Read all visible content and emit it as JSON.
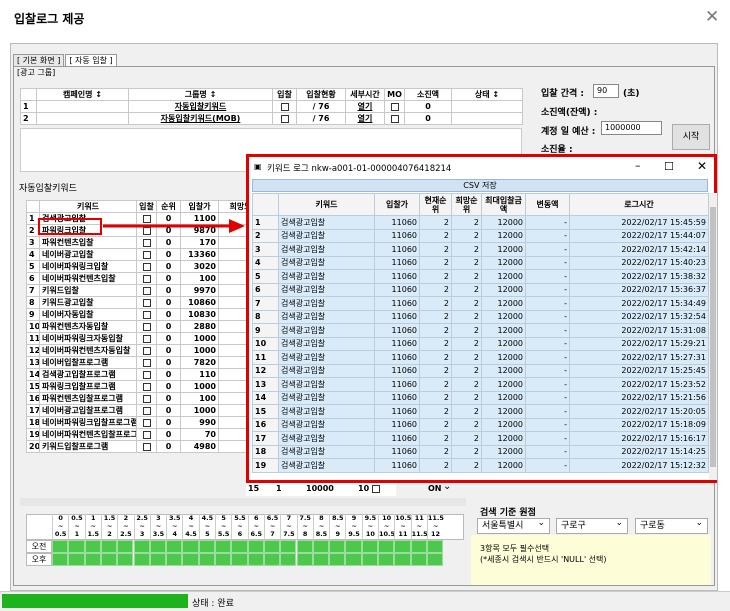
{
  "dialog": {
    "title": "입찰로그 제공"
  },
  "tabs": [
    "[ 기본 화면 ]",
    "[ 자동 입찰 ]"
  ],
  "ad_group": {
    "label": "[광고 그룹]",
    "headers": [
      "캠페인명 ↕",
      "그룹명 ↕",
      "입찰",
      "입찰현황",
      "세부시간",
      "MO",
      "소진액",
      "상태 ↕"
    ],
    "rows": [
      {
        "n": "1",
        "group": "자동입찰키워드",
        "status": "/ 76",
        "time": "열기",
        "spent": "0"
      },
      {
        "n": "2",
        "group": "자동입찰키워드(MOB)",
        "status": "/ 76",
        "time": "열기",
        "spent": "0"
      }
    ]
  },
  "settings": {
    "interval_label": "입찰 간격 :",
    "interval_value": "90",
    "interval_unit": "(초)",
    "spent_label": "소진액(잔액) :",
    "budget_label": "계정 일 예산 :",
    "budget_value": "1000000",
    "rate_label": "소진율 :",
    "start_label": "시작"
  },
  "keywords": {
    "label": "자동입찰키워드",
    "headers": [
      "키워드",
      "입찰",
      "순위",
      "입찰가",
      "희망노"
    ],
    "rows": [
      {
        "n": "1",
        "kw": "검색광고입찰",
        "rank": "0",
        "bid": "1100"
      },
      {
        "n": "2",
        "kw": "파워링크입찰",
        "rank": "0",
        "bid": "9870"
      },
      {
        "n": "3",
        "kw": "파워컨텐츠입찰",
        "rank": "0",
        "bid": "170"
      },
      {
        "n": "4",
        "kw": "네이버광고입찰",
        "rank": "0",
        "bid": "13360"
      },
      {
        "n": "5",
        "kw": "네이버파워링크입찰",
        "rank": "0",
        "bid": "3020"
      },
      {
        "n": "6",
        "kw": "네이버파워컨텐츠입찰",
        "rank": "0",
        "bid": "100"
      },
      {
        "n": "7",
        "kw": "키워드입찰",
        "rank": "0",
        "bid": "9970"
      },
      {
        "n": "8",
        "kw": "키워드광고입찰",
        "rank": "0",
        "bid": "10860"
      },
      {
        "n": "9",
        "kw": "네이버자동입찰",
        "rank": "0",
        "bid": "10830"
      },
      {
        "n": "10",
        "kw": "파워컨텐츠자동입찰",
        "rank": "0",
        "bid": "2880"
      },
      {
        "n": "11",
        "kw": "네이버파워링크자동입찰",
        "rank": "0",
        "bid": "1000"
      },
      {
        "n": "12",
        "kw": "네이버파워컨텐츠자동입찰",
        "rank": "0",
        "bid": "1000"
      },
      {
        "n": "13",
        "kw": "네이버입찰프로그램",
        "rank": "0",
        "bid": "7820"
      },
      {
        "n": "14",
        "kw": "검색광고입찰프로그램",
        "rank": "0",
        "bid": "110"
      },
      {
        "n": "15",
        "kw": "파워링크입찰프로그램",
        "rank": "0",
        "bid": "1000"
      },
      {
        "n": "16",
        "kw": "파워컨텐츠입찰프로그램",
        "rank": "0",
        "bid": "100"
      },
      {
        "n": "17",
        "kw": "네이버광고입찰프로그램",
        "rank": "0",
        "bid": "1000"
      },
      {
        "n": "18",
        "kw": "네이버파워링크입찰프로그램",
        "rank": "0",
        "bid": "990"
      },
      {
        "n": "19",
        "kw": "네이버파워컨텐츠입찰프로그램",
        "rank": "0",
        "bid": "70"
      },
      {
        "n": "20",
        "kw": "키워드입찰프로그램",
        "rank": "0",
        "bid": "4980"
      }
    ],
    "last_row_extra": {
      "c1": "15",
      "c2": "1",
      "c3": "10000",
      "c4": "10",
      "state": "ON"
    }
  },
  "time_grid": {
    "top": [
      "0",
      "0.5",
      "1",
      "1.5",
      "2",
      "2.5",
      "3",
      "3.5",
      "4",
      "4.5",
      "5",
      "5.5",
      "6",
      "6.5",
      "7",
      "7.5",
      "8",
      "8.5",
      "9",
      "9.5",
      "10",
      "10.5",
      "11",
      "11.5"
    ],
    "tilde": "~",
    "bottom": [
      "0.5",
      "1",
      "1.5",
      "2",
      "2.5",
      "3",
      "3.5",
      "4",
      "4.5",
      "5",
      "5.5",
      "6",
      "6.5",
      "7",
      "7.5",
      "8",
      "8.5",
      "9",
      "9.5",
      "10",
      "10.5",
      "11",
      "11.5",
      "12"
    ],
    "am": "오전",
    "pm": "오후"
  },
  "search_region": {
    "label": "검색 기준 원점",
    "city": "서울특별시",
    "district": "구로구",
    "dong": "구로동",
    "note1": "3항목 모두 필수선택",
    "note2": "(*세종시 검색시 반드시 'NULL' 선택)"
  },
  "status": {
    "text": "상태 : 완료",
    "progress": 1.0
  },
  "log_window": {
    "title": "키워드 로그 nkw-a001-01-000004076418214",
    "csv": "CSV 저장",
    "headers": [
      "키워드",
      "입찰가",
      "현재순위",
      "희망순위",
      "최대입찰금액",
      "변동액",
      "로그시간"
    ],
    "rows": [
      {
        "n": "1",
        "kw": "검색광고입찰",
        "bid": "11060",
        "cur": "2",
        "hope": "2",
        "max": "12000",
        "chg": "-",
        "time": "2022/02/17 15:45:59"
      },
      {
        "n": "2",
        "kw": "검색광고입찰",
        "bid": "11060",
        "cur": "2",
        "hope": "2",
        "max": "12000",
        "chg": "-",
        "time": "2022/02/17 15:44:07"
      },
      {
        "n": "3",
        "kw": "검색광고입찰",
        "bid": "11060",
        "cur": "2",
        "hope": "2",
        "max": "12000",
        "chg": "-",
        "time": "2022/02/17 15:42:14"
      },
      {
        "n": "4",
        "kw": "검색광고입찰",
        "bid": "11060",
        "cur": "2",
        "hope": "2",
        "max": "12000",
        "chg": "-",
        "time": "2022/02/17 15:40:23"
      },
      {
        "n": "5",
        "kw": "검색광고입찰",
        "bid": "11060",
        "cur": "2",
        "hope": "2",
        "max": "12000",
        "chg": "-",
        "time": "2022/02/17 15:38:32"
      },
      {
        "n": "6",
        "kw": "검색광고입찰",
        "bid": "11060",
        "cur": "2",
        "hope": "2",
        "max": "12000",
        "chg": "-",
        "time": "2022/02/17 15:36:37"
      },
      {
        "n": "7",
        "kw": "검색광고입찰",
        "bid": "11060",
        "cur": "2",
        "hope": "2",
        "max": "12000",
        "chg": "-",
        "time": "2022/02/17 15:34:49"
      },
      {
        "n": "8",
        "kw": "검색광고입찰",
        "bid": "11060",
        "cur": "2",
        "hope": "2",
        "max": "12000",
        "chg": "-",
        "time": "2022/02/17 15:32:54"
      },
      {
        "n": "9",
        "kw": "검색광고입찰",
        "bid": "11060",
        "cur": "2",
        "hope": "2",
        "max": "12000",
        "chg": "-",
        "time": "2022/02/17 15:31:08"
      },
      {
        "n": "10",
        "kw": "검색광고입찰",
        "bid": "11060",
        "cur": "2",
        "hope": "2",
        "max": "12000",
        "chg": "-",
        "time": "2022/02/17 15:29:21"
      },
      {
        "n": "11",
        "kw": "검색광고입찰",
        "bid": "11060",
        "cur": "2",
        "hope": "2",
        "max": "12000",
        "chg": "-",
        "time": "2022/02/17 15:27:31"
      },
      {
        "n": "12",
        "kw": "검색광고입찰",
        "bid": "11060",
        "cur": "2",
        "hope": "2",
        "max": "12000",
        "chg": "-",
        "time": "2022/02/17 15:25:45"
      },
      {
        "n": "13",
        "kw": "검색광고입찰",
        "bid": "11060",
        "cur": "2",
        "hope": "2",
        "max": "12000",
        "chg": "-",
        "time": "2022/02/17 15:23:52"
      },
      {
        "n": "14",
        "kw": "검색광고입찰",
        "bid": "11060",
        "cur": "2",
        "hope": "2",
        "max": "12000",
        "chg": "-",
        "time": "2022/02/17 15:21:56"
      },
      {
        "n": "15",
        "kw": "검색광고입찰",
        "bid": "11060",
        "cur": "2",
        "hope": "2",
        "max": "12000",
        "chg": "-",
        "time": "2022/02/17 15:20:05"
      },
      {
        "n": "16",
        "kw": "검색광고입찰",
        "bid": "11060",
        "cur": "2",
        "hope": "2",
        "max": "12000",
        "chg": "-",
        "time": "2022/02/17 15:18:09"
      },
      {
        "n": "17",
        "kw": "검색광고입찰",
        "bid": "11060",
        "cur": "2",
        "hope": "2",
        "max": "12000",
        "chg": "-",
        "time": "2022/02/17 15:16:17"
      },
      {
        "n": "18",
        "kw": "검색광고입찰",
        "bid": "11060",
        "cur": "2",
        "hope": "2",
        "max": "12000",
        "chg": "-",
        "time": "2022/02/17 15:14:25"
      },
      {
        "n": "19",
        "kw": "검색광고입찰",
        "bid": "11060",
        "cur": "2",
        "hope": "2",
        "max": "12000",
        "chg": "-",
        "time": "2022/02/17 15:12:32"
      }
    ]
  },
  "colors": {
    "highlight": "#e00000",
    "progress": "#1db31d",
    "csv_bar": "#cfe3f3",
    "note_bg": "#fdfdd8"
  }
}
